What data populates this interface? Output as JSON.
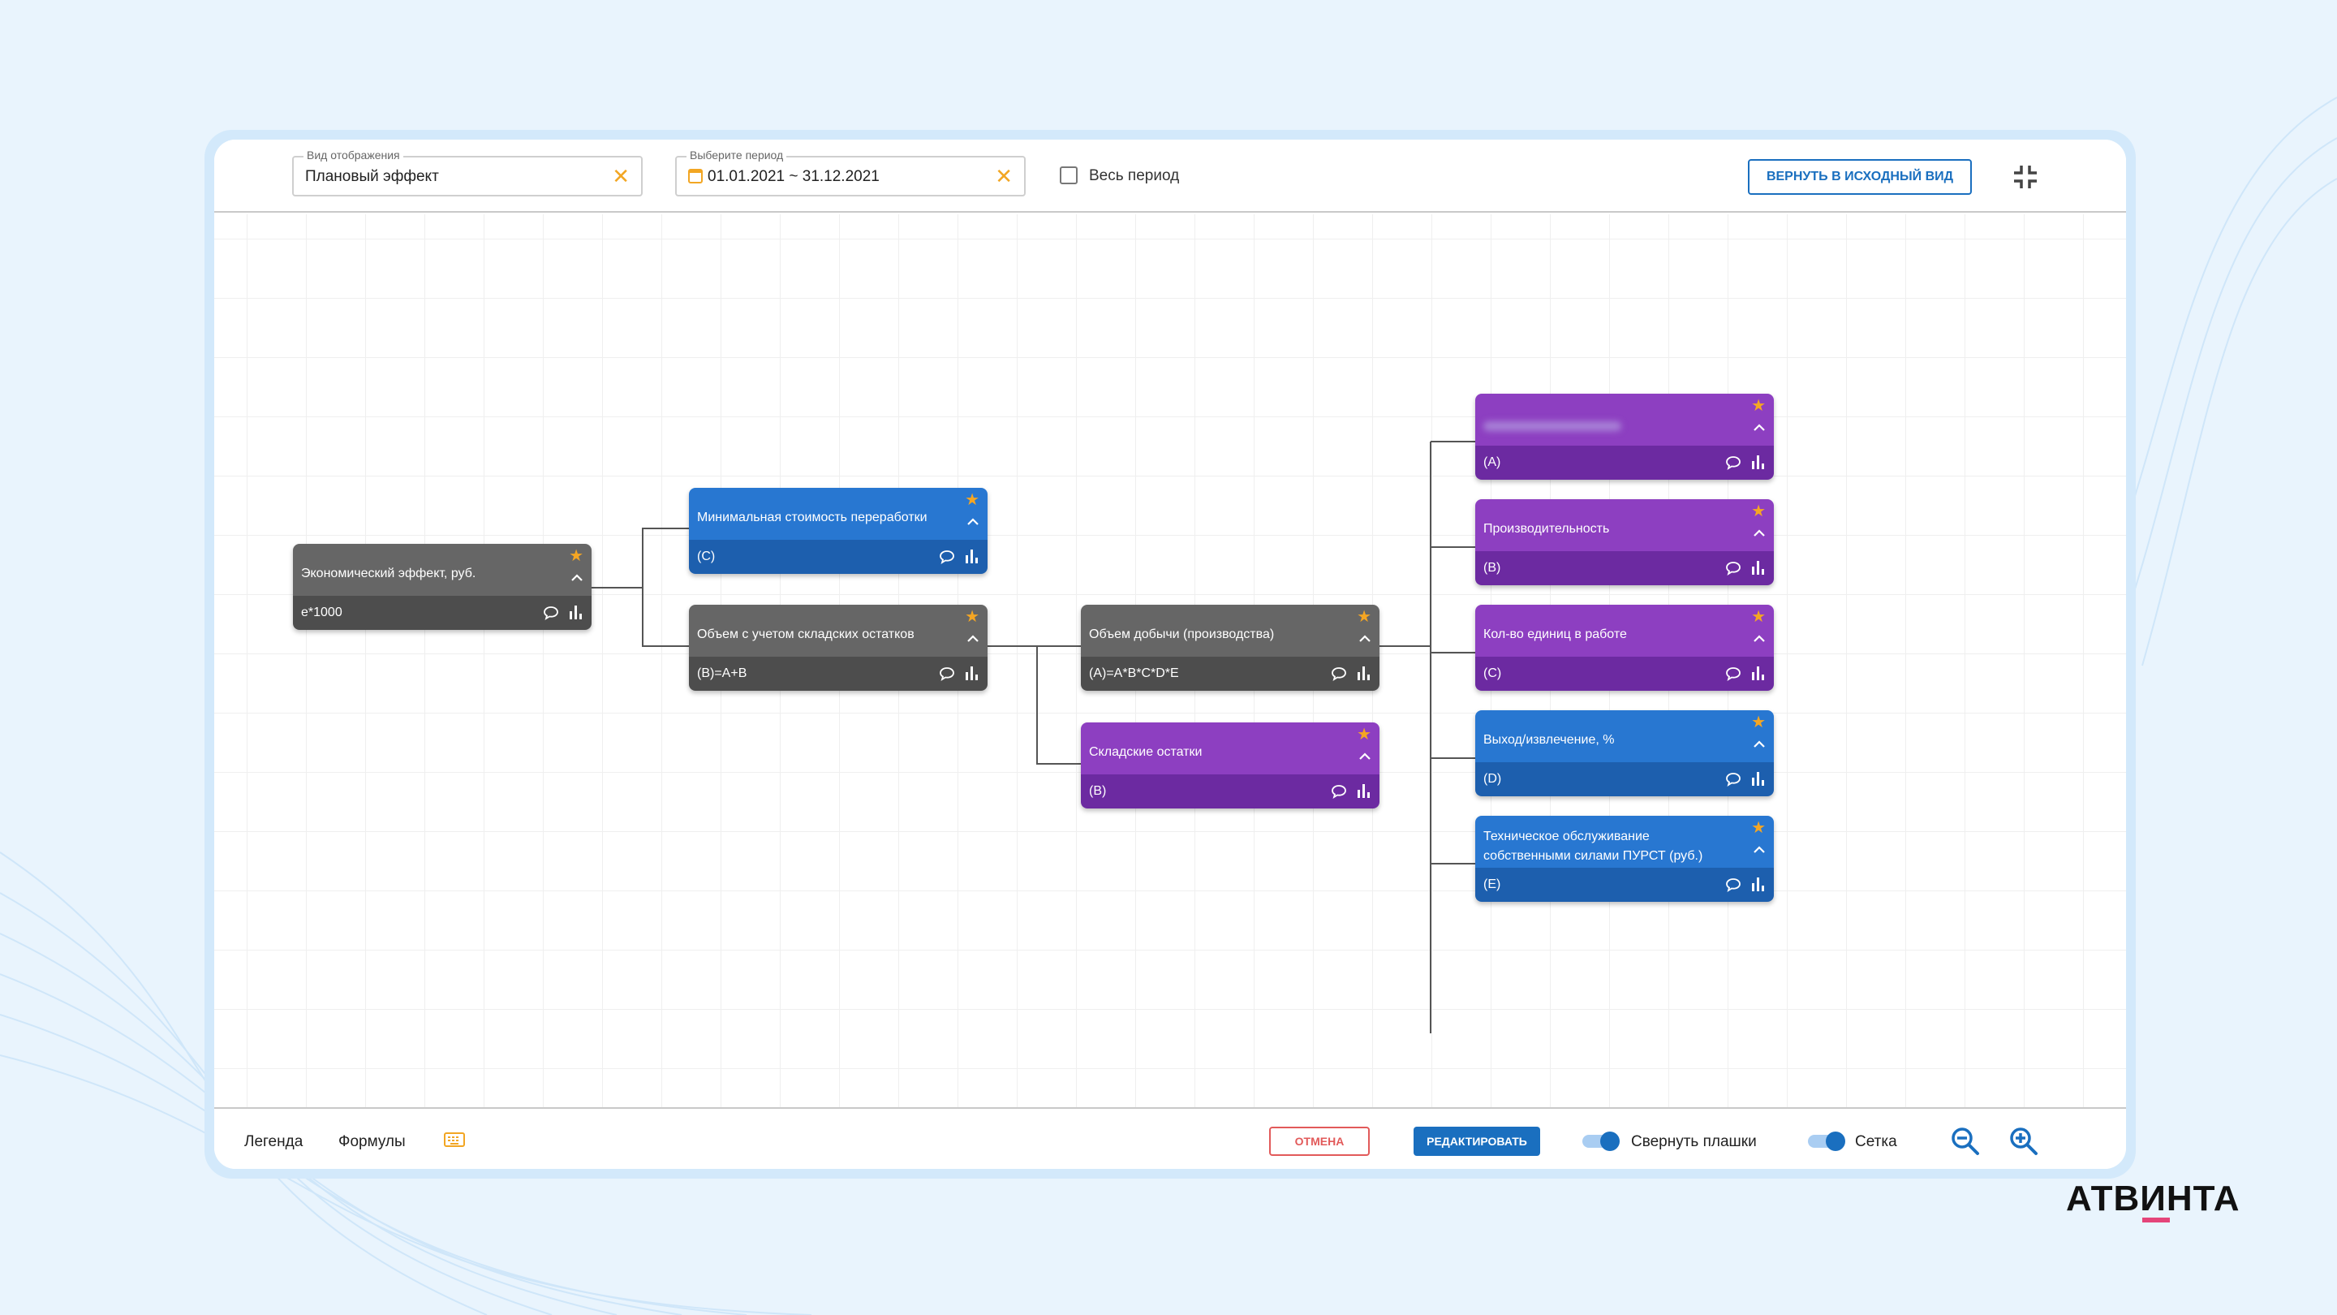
{
  "header": {
    "view_field": {
      "label": "Вид отображения",
      "value": "Плановый эффект"
    },
    "period_field": {
      "label": "Выберите период",
      "value": "01.01.2021 ~ 31.12.2021"
    },
    "whole_period_label": "Весь период",
    "reset_button_label": "ВЕРНУТЬ В ИСХОДНЫЙ ВИД"
  },
  "nodes": [
    {
      "id": "root",
      "title": "Экономический эффект, руб.",
      "code": "e*1000",
      "color": "#666666"
    },
    {
      "id": "min_cost",
      "title": "Минимальная стоимость переработки",
      "code": "(C)",
      "color": "#2877d1"
    },
    {
      "id": "volume_stock",
      "title": "Объем с учетом складских остатков",
      "code": "(B)=A+B",
      "color": "#666666"
    },
    {
      "id": "production",
      "title": "Объем добычи (производства)",
      "code": "(A)=A*B*C*D*E",
      "color": "#666666"
    },
    {
      "id": "stock",
      "title": "Складские остатки",
      "code": "(B)",
      "color": "#8d3fc1"
    },
    {
      "id": "hidden",
      "title": "",
      "code": "(A)",
      "color": "#8d3fc1"
    },
    {
      "id": "productivity",
      "title": "Производительность",
      "code": "(B)",
      "color": "#8d3fc1"
    },
    {
      "id": "units",
      "title": "Кол-во единиц в работе",
      "code": "(C)",
      "color": "#8d3fc1"
    },
    {
      "id": "yield",
      "title": "Выход/извлечение, %",
      "code": "(D)",
      "color": "#2877d1"
    },
    {
      "id": "maintenance",
      "title": "Техническое обслуживание собственными силами ПУРСТ (руб.)",
      "code": "(E)",
      "color": "#2877d1"
    }
  ],
  "footer": {
    "legend_label": "Легенда",
    "formulas_label": "Формулы",
    "cancel_label": "ОТМЕНА",
    "edit_label": "РЕДАКТИРОВАТЬ",
    "collapse_cards_label": "Свернуть плашки",
    "grid_label": "Сетка"
  },
  "brand": {
    "logo_text": "АТВИНТА",
    "accent": "#e4447a"
  },
  "colors": {
    "primary": "#1a6fbf",
    "star": "#f5a623",
    "cancel": "#e25a5a"
  }
}
